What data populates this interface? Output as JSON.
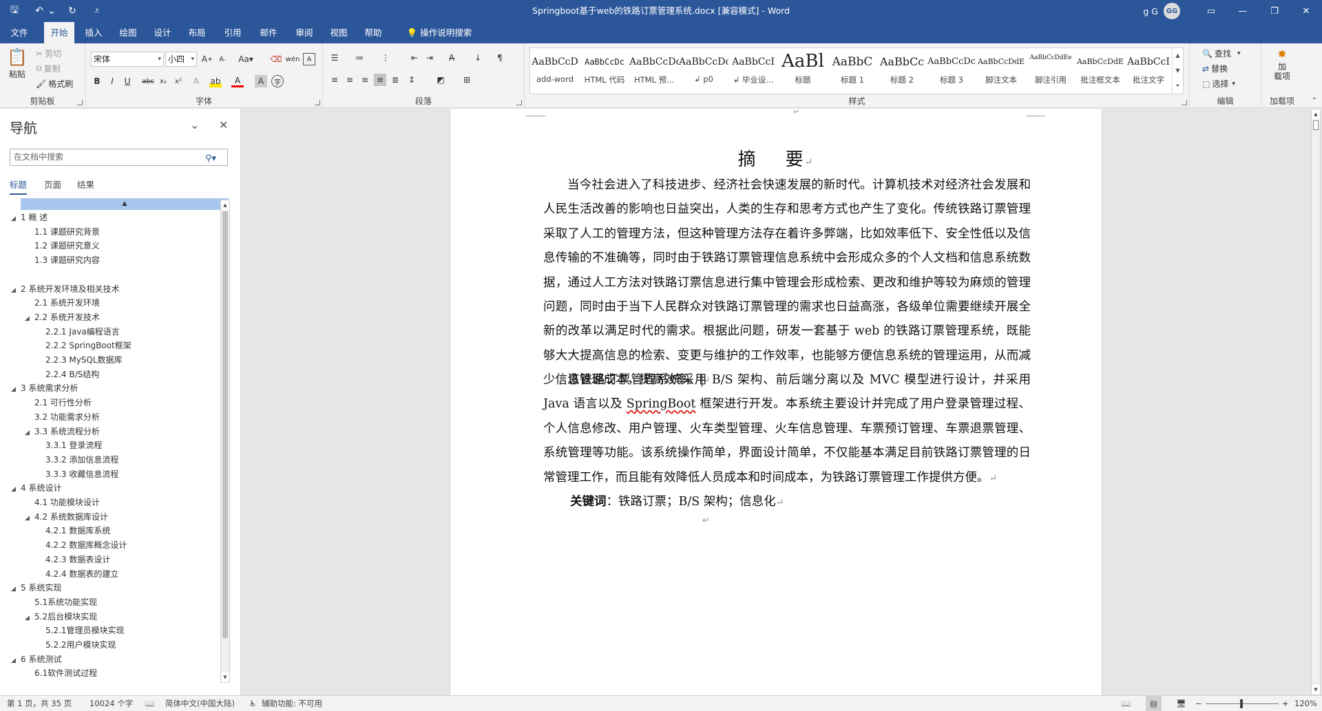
{
  "titlebar": {
    "title": "Springboot基于web的铁路订票管理系统.docx [兼容模式]  -  Word",
    "user": "g G",
    "avatar": "GG",
    "quick_access": [
      {
        "icon": "save-icon",
        "glyph": "🖫"
      },
      {
        "icon": "undo-icon",
        "glyph": "↶"
      },
      {
        "icon": "undo-dropdown-icon",
        "glyph": "⌄"
      },
      {
        "icon": "redo-icon",
        "glyph": "↻"
      },
      {
        "icon": "customize-qa-icon",
        "glyph": "⩡"
      }
    ]
  },
  "tabs": [
    "文件",
    "开始",
    "插入",
    "绘图",
    "设计",
    "布局",
    "引用",
    "邮件",
    "审阅",
    "视图",
    "帮助"
  ],
  "active_tab": "开始",
  "tell_me": "操作说明搜索",
  "ribbon": {
    "clipboard": {
      "label": "剪贴板",
      "paste": "粘贴",
      "cut": "剪切",
      "copy": "复制",
      "format_painter": "格式刷"
    },
    "font": {
      "label": "字体",
      "font_name": "宋体",
      "font_size": "小四",
      "change_case": "Aa"
    },
    "paragraph": {
      "label": "段落"
    },
    "styles": {
      "label": "样式",
      "items": [
        {
          "preview": "AaBbCcD",
          "name": "add-word"
        },
        {
          "preview": "AaBbCcDc",
          "name": "HTML 代码"
        },
        {
          "preview": "AaBbCcDc",
          "name": "HTML 预..."
        },
        {
          "preview": "AaBbCcDc",
          "name": "↲ p0"
        },
        {
          "preview": "AaBbCcI",
          "name": "↲ 毕业设..."
        },
        {
          "preview": "AaBl",
          "name": "标题"
        },
        {
          "preview": "AaBbC",
          "name": "标题 1"
        },
        {
          "preview": "AaBbCc",
          "name": "标题 2"
        },
        {
          "preview": "AaBbCcDc",
          "name": "标题 3"
        },
        {
          "preview": "AaBbCcDdE",
          "name": "脚注文本"
        },
        {
          "preview": "AaBbCcDdEe",
          "name": "脚注引用"
        },
        {
          "preview": "AaBbCcDdE",
          "name": "批注框文本"
        },
        {
          "preview": "AaBbCcI",
          "name": "批注文字"
        }
      ]
    },
    "editing": {
      "label": "编辑",
      "find": "查找",
      "replace": "替换",
      "select": "选择"
    },
    "addins": {
      "label": "加载项",
      "button": "加\n载项"
    }
  },
  "nav": {
    "title": "导航",
    "search_placeholder": "在文档中搜索",
    "tabs": [
      "标题",
      "页面",
      "结果"
    ],
    "items": [
      {
        "text": "1  概    述",
        "level": 1,
        "expanded": true
      },
      {
        "text": "1.1 课题研究背景",
        "level": 2
      },
      {
        "text": "1.2 课题研究意义",
        "level": 2
      },
      {
        "text": "1.3 课题研究内容",
        "level": 2
      },
      {
        "text": "",
        "level": 2
      },
      {
        "text": "2  系统开发环境及相关技术",
        "level": 1,
        "expanded": true
      },
      {
        "text": "2.1 系统开发环境",
        "level": 2
      },
      {
        "text": "2.2 系统开发技术",
        "level": 2,
        "expanded": true
      },
      {
        "text": "2.2.1 Java编程语言",
        "level": 3
      },
      {
        "text": "2.2.2 SpringBoot框架",
        "level": 3
      },
      {
        "text": "2.2.3 MySQL数据库",
        "level": 3
      },
      {
        "text": "2.2.4 B/S结构",
        "level": 3
      },
      {
        "text": "3  系统需求分析",
        "level": 1,
        "expanded": true
      },
      {
        "text": "2.1 可行性分析",
        "level": 2
      },
      {
        "text": "3.2 功能需求分析",
        "level": 2
      },
      {
        "text": "3.3 系统流程分析",
        "level": 2,
        "expanded": true
      },
      {
        "text": "3.3.1 登录流程",
        "level": 3
      },
      {
        "text": "3.3.2 添加信息流程",
        "level": 3
      },
      {
        "text": "3.3.3 收藏信息流程",
        "level": 3
      },
      {
        "text": "4  系统设计",
        "level": 1,
        "expanded": true
      },
      {
        "text": "4.1 功能模块设计",
        "level": 2
      },
      {
        "text": "4.2 系统数据库设计",
        "level": 2,
        "expanded": true
      },
      {
        "text": "4.2.1 数据库系统",
        "level": 3
      },
      {
        "text": "4.2.2 数据库概念设计",
        "level": 3
      },
      {
        "text": "4.2.3 数据表设计",
        "level": 3
      },
      {
        "text": "4.2.4 数据表的建立",
        "level": 3
      },
      {
        "text": "5  系统实现",
        "level": 1,
        "expanded": true
      },
      {
        "text": "5.1系统功能实现",
        "level": 2
      },
      {
        "text": "5.2后台模块实现",
        "level": 2,
        "expanded": true
      },
      {
        "text": "5.2.1管理员模块实现",
        "level": 3
      },
      {
        "text": "5.2.2用户模块实现",
        "level": 3
      },
      {
        "text": "6  系统测试",
        "level": 1,
        "expanded": true
      },
      {
        "text": "6.1软件测试过程",
        "level": 2
      }
    ]
  },
  "document": {
    "heading": "摘    要",
    "para1": "当今社会进入了科技进步、经济社会快速发展的新时代。计算机技术对经济社会发展和人民生活改善的影响也日益突出，人类的生存和思考方式也产生了变化。传统铁路订票管理采取了人工的管理方法，但这种管理方法存在着许多弊端，比如效率低下、安全性低以及信息传输的不准确等，同时由于铁路订票管理信息系统中会形成众多的个人文档和信息系统数据，通过人工方法对铁路订票信息进行集中管理会形成检索、更改和维护等较为麻烦的管理问题，同时由于当下人民群众对铁路订票管理的需求也日益高涨，各级单位需要继续开展全新的改革以满足时代的需求。根据此问题，研发一套基于 web 的铁路订票管理系统，既能够大大提高信息的检索、变更与维护的工作效率，也能够方便信息系统的管理运用，从而减少信息管理成本，提高效率。",
    "para2_a": "该铁路订票管理系统采用 B/S 架构、前后端分离以及 MVC 模型进行设计，并采用 Java 语言以及 ",
    "para2_spell": "SpringBoot",
    "para2_b": " 框架进行开发。本系统主要设计并完成了用户登录管理过程、个人信息修改、用户管理、火车类型管理、火车信息管理、车票预订管理、车票退票管理、系统管理等功能。该系统操作简单，界面设计简单，不仅能基本满足目前铁路订票管理的日常管理工作，而且能有效降低人员成本和时间成本，为铁路订票管理工作提供方便。",
    "keywords_label": "关键词",
    "keywords": "：铁路订票；B/S 架构；信息化",
    "para_mark": "↵"
  },
  "status": {
    "page": "第 1 页，共 35 页",
    "words": "10024 个字",
    "language": "简体中文(中国大陆)",
    "accessibility": "辅助功能: 不可用",
    "zoom": "120%"
  },
  "colors": {
    "brand": "#2b579a",
    "ribbon": "#f3f3f3",
    "canvas": "#e6e6e6"
  }
}
